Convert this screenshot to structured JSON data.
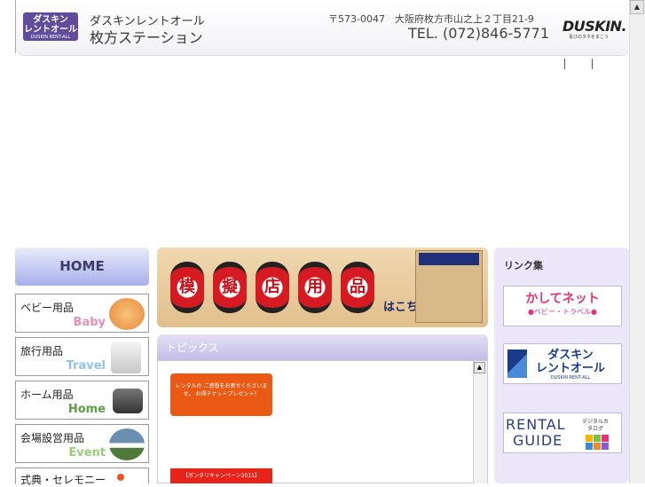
{
  "header": {
    "logo_line1": "ダスキン",
    "logo_line2": "レントオール",
    "logo_line3": "DUSKIN RENT-ALL",
    "company": "ダスキンレントオール",
    "station": "枚方ステーション",
    "address": "〒573-0047　大阪府枚方市山之上２丁目21-9",
    "tel": "TEL. (072)846-5771",
    "brand": "DUSKIN.",
    "brand_sub": "喜びのタネをまこう"
  },
  "nav": {
    "home": "HOME",
    "items": [
      {
        "jp": "ベビー用品",
        "en": "Baby",
        "color": "#e98fb6"
      },
      {
        "jp": "旅行用品",
        "en": "Travel",
        "color": "#8fc4e6"
      },
      {
        "jp": "ホーム用品",
        "en": "Home",
        "color": "#5aa040"
      },
      {
        "jp": "会場設営用品",
        "en": "Event",
        "color": "#9acd7a"
      },
      {
        "jp": "式典・セレモニー",
        "en": "",
        "color": "#999999"
      }
    ]
  },
  "banner": {
    "lanterns": [
      "模",
      "擬",
      "店",
      "用",
      "品"
    ],
    "suffix": "はこちら"
  },
  "topics": {
    "title": "トピックス",
    "item1": "レンタルの ご感想をお寄せくださいませ。 お得チケットプレゼント！",
    "item2": "【ポンタリキャンペーン2011】"
  },
  "links": {
    "title": "リンク集",
    "kashite": {
      "title": "かしてネット",
      "sub": "●ベビー・トラベル●"
    },
    "rentall": {
      "title1": "ダスキン",
      "title2": "レントオール",
      "sub": "DUSKIN RENT-ALL"
    },
    "guide": {
      "title1": "RENTAL",
      "title2": "GUIDE",
      "note": "デジタルカタログ"
    }
  }
}
